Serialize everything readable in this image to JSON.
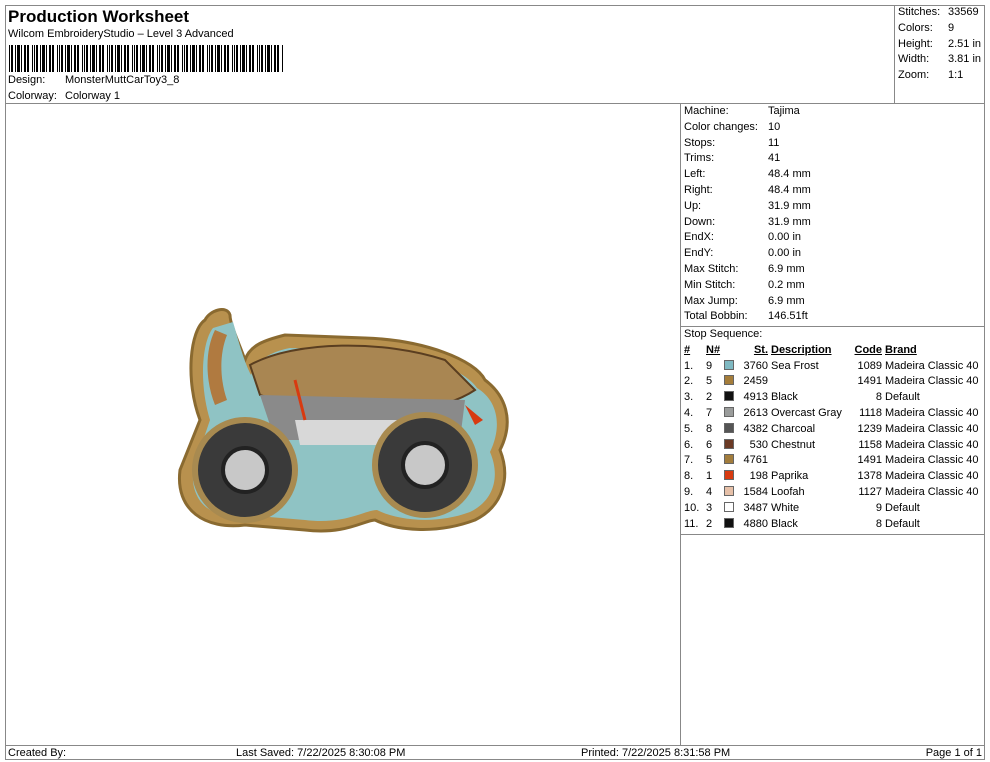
{
  "header": {
    "title": "Production Worksheet",
    "subtitle": "Wilcom EmbroideryStudio – Level 3 Advanced",
    "design_label": "Design:",
    "design": "MonsterMuttCarToy3_8",
    "colorway_label": "Colorway:",
    "colorway": "Colorway 1"
  },
  "stats": [
    {
      "k": "Stitches:",
      "v": "33569"
    },
    {
      "k": "Colors:",
      "v": "9"
    },
    {
      "k": "Height:",
      "v": "2.51 in"
    },
    {
      "k": "Width:",
      "v": "3.81 in"
    },
    {
      "k": "Zoom:",
      "v": "1:1"
    }
  ],
  "info": [
    {
      "k": "Machine:",
      "v": "Tajima"
    },
    {
      "k": "Color changes:",
      "v": "10"
    },
    {
      "k": "Stops:",
      "v": "11"
    },
    {
      "k": "Trims:",
      "v": "41"
    },
    {
      "k": "Left:",
      "v": "48.4 mm"
    },
    {
      "k": "Right:",
      "v": "48.4 mm"
    },
    {
      "k": "Up:",
      "v": "31.9 mm"
    },
    {
      "k": "Down:",
      "v": "31.9 mm"
    },
    {
      "k": "EndX:",
      "v": "0.00 in"
    },
    {
      "k": "EndY:",
      "v": "0.00 in"
    },
    {
      "k": "Max Stitch:",
      "v": "6.9 mm"
    },
    {
      "k": "Min Stitch:",
      "v": "0.2 mm"
    },
    {
      "k": "Max Jump:",
      "v": "6.9 mm"
    },
    {
      "k": "Total Bobbin:",
      "v": "146.51ft"
    }
  ],
  "sequence": {
    "label": "Stop Sequence:",
    "headers": [
      "#",
      "N#",
      "St.",
      "Description",
      "Code",
      "Brand"
    ],
    "rows": [
      {
        "n": "1.",
        "nn": "9",
        "color": "#7fb9c2",
        "st": "3760",
        "desc": "Sea Frost",
        "code": "1089",
        "brand": "Madeira Classic 40"
      },
      {
        "n": "2.",
        "nn": "5",
        "color": "#a57d3a",
        "st": "2459",
        "desc": "",
        "code": "1491",
        "brand": "Madeira Classic 40"
      },
      {
        "n": "3.",
        "nn": "2",
        "color": "#111111",
        "st": "4913",
        "desc": "Black",
        "code": "8",
        "brand": "Default"
      },
      {
        "n": "4.",
        "nn": "7",
        "color": "#9a9c9b",
        "st": "2613",
        "desc": "Overcast Gray",
        "code": "1118",
        "brand": "Madeira Classic 40"
      },
      {
        "n": "5.",
        "nn": "8",
        "color": "#555555",
        "st": "4382",
        "desc": "Charcoal",
        "code": "1239",
        "brand": "Madeira Classic 40"
      },
      {
        "n": "6.",
        "nn": "6",
        "color": "#6b3a25",
        "st": "530",
        "desc": "Chestnut",
        "code": "1158",
        "brand": "Madeira Classic 40"
      },
      {
        "n": "7.",
        "nn": "5",
        "color": "#a27c3c",
        "st": "4761",
        "desc": "",
        "code": "1491",
        "brand": "Madeira Classic 40"
      },
      {
        "n": "8.",
        "nn": "1",
        "color": "#d83a10",
        "st": "198",
        "desc": "Paprika",
        "code": "1378",
        "brand": "Madeira Classic 40"
      },
      {
        "n": "9.",
        "nn": "4",
        "color": "#e6c0a8",
        "st": "1584",
        "desc": "Loofah",
        "code": "1127",
        "brand": "Madeira Classic 40"
      },
      {
        "n": "10.",
        "nn": "3",
        "color": "#ffffff",
        "st": "3487",
        "desc": "White",
        "code": "9",
        "brand": "Default"
      },
      {
        "n": "11.",
        "nn": "2",
        "color": "#111111",
        "st": "4880",
        "desc": "Black",
        "code": "8",
        "brand": "Default"
      }
    ]
  },
  "footer": {
    "created": "Created By:",
    "saved": "Last Saved: 7/22/2025 8:30:08 PM",
    "printed": "Printed: 7/22/2025 8:31:58 PM",
    "page": "Page 1 of 1"
  }
}
